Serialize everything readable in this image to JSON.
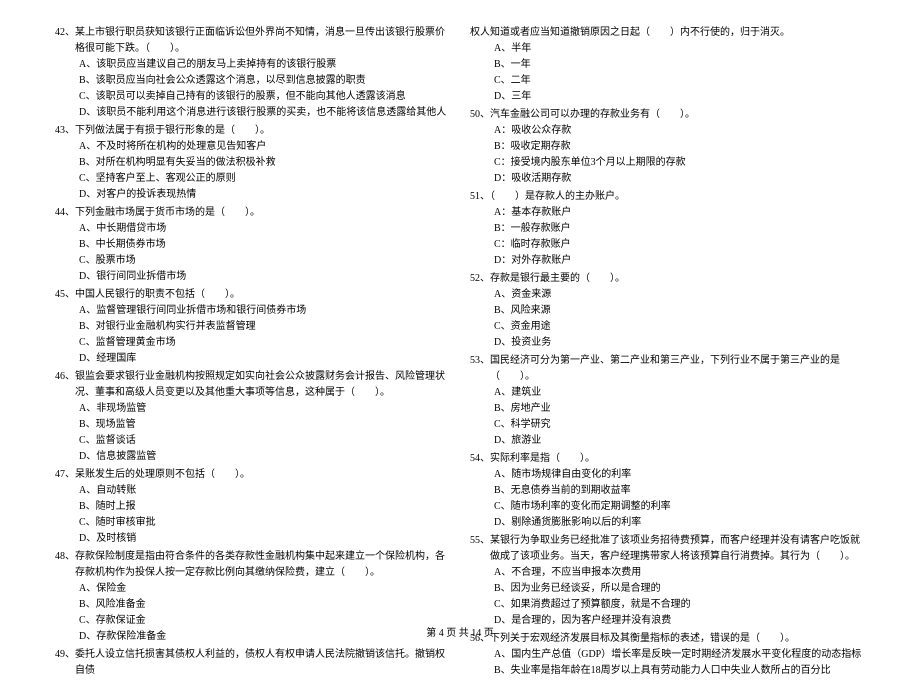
{
  "left": {
    "q42": {
      "text": "42、某上市银行职员获知该银行正面临诉讼但外界尚不知情，消息一旦传出该银行股票价格很可能下跌。（　　）。",
      "optA": "A、该职员应当建议自己的朋友马上卖掉持有的该银行股票",
      "optB": "B、该职员应当向社会公众透露这个消息，以尽到信息披露的职责",
      "optC": "C、该职员可以卖掉自己持有的该银行的股票，但不能向其他人透露该消息",
      "optD": "D、该职员不能利用这个消息进行该银行股票的买卖，也不能将该信息透露给其他人"
    },
    "q43": {
      "text": "43、下列做法属于有损于银行形象的是（　　）。",
      "optA": "A、不及时将所在机构的处理意见告知客户",
      "optB": "B、对所在机构明显有失妥当的做法积极补救",
      "optC": "C、坚持客户至上、客观公正的原则",
      "optD": "D、对客户的投诉表现热情"
    },
    "q44": {
      "text": "44、下列金融市场属于货币市场的是（　　）。",
      "optA": "A、中长期借贷市场",
      "optB": "B、中长期债券市场",
      "optC": "C、股票市场",
      "optD": "D、银行间同业拆借市场"
    },
    "q45": {
      "text": "45、中国人民银行的职责不包括（　　）。",
      "optA": "A、监督管理银行间同业拆借市场和银行间债券市场",
      "optB": "B、对银行业金融机构实行并表监督管理",
      "optC": "C、监督管理黄金市场",
      "optD": "D、经理国库"
    },
    "q46": {
      "text": "46、银监会要求银行业金融机构按照规定如实向社会公众披露财务会计报告、风险管理状况、董事和高级人员变更以及其他重大事项等信息，这种属于（　　）。",
      "optA": "A、非现场监管",
      "optB": "B、现场监管",
      "optC": "C、监督谈话",
      "optD": "D、信息披露监管"
    },
    "q47": {
      "text": "47、呆账发生后的处理原则不包括（　　）。",
      "optA": "A、自动转账",
      "optB": "B、随时上报",
      "optC": "C、随时审核审批",
      "optD": "D、及时核销"
    },
    "q48": {
      "text": "48、存款保险制度是指由符合条件的各类存款性金融机构集中起来建立一个保险机构，各存款机构作为投保人按一定存款比例向其缴纳保险费，建立（　　）。",
      "optA": "A、保险金",
      "optB": "B、风险准备金",
      "optC": "C、存款保证金",
      "optD": "D、存款保险准备金"
    },
    "q49": {
      "text": "49、委托人设立信托损害其债权人利益的，债权人有权申请人民法院撤销该信托。撤销权自债"
    }
  },
  "right": {
    "q49cont": {
      "text": "权人知道或者应当知道撤销原因之日起（　　）内不行使的，归于消灭。",
      "optA": "A、半年",
      "optB": "B、一年",
      "optC": "C、二年",
      "optD": "D、三年"
    },
    "q50": {
      "text": "50、汽车金融公司可以办理的存款业务有（　　）。",
      "optA": "A：吸收公众存款",
      "optB": "B：吸收定期存款",
      "optC": "C：接受境内股东单位3个月以上期限的存款",
      "optD": "D：吸收活期存款"
    },
    "q51": {
      "text": "51、（　　）是存款人的主办账户。",
      "optA": "A：基本存款账户",
      "optB": "B：一般存款账户",
      "optC": "C：临时存款账户",
      "optD": "D：对外存款账户"
    },
    "q52": {
      "text": "52、存款是银行最主要的（　　）。",
      "optA": "A、资金来源",
      "optB": "B、风险来源",
      "optC": "C、资金用途",
      "optD": "D、投资业务"
    },
    "q53": {
      "text": "53、国民经济可分为第一产业、第二产业和第三产业，下列行业不属于第三产业的是（　　）。",
      "optA": "A、建筑业",
      "optB": "B、房地产业",
      "optC": "C、科学研究",
      "optD": "D、旅游业"
    },
    "q54": {
      "text": "54、实际利率是指（　　）。",
      "optA": "A、随市场规律自由变化的利率",
      "optB": "B、无息债券当前的到期收益率",
      "optC": "C、随市场利率的变化而定期调整的利率",
      "optD": "D、剔除通货膨胀影响以后的利率"
    },
    "q55": {
      "text": "55、某银行为争取业务已经批准了该项业务招待费预算，而客户经理并没有请客户吃饭就做成了该项业务。当天，客户经理携带家人将该预算自行消费掉。其行为（　　）。",
      "optA": "A、不合理，不应当申报本次费用",
      "optB": "B、因为业务已经谈妥，所以是合理的",
      "optC": "C、如果消费超过了预算额度，就是不合理的",
      "optD": "D、是合理的，因为客户经理并没有浪费"
    },
    "q56": {
      "text": "56、下列关于宏观经济发展目标及其衡量指标的表述，错误的是（　　）。",
      "optA": "A、国内生产总值（GDP）增长率是反映一定时期经济发展水平变化程度的动态指标",
      "optB": "B、失业率是指年龄在18周岁以上具有劳动能力人口中失业人数所占的百分比"
    }
  },
  "footer": "第 4 页 共 14 页"
}
